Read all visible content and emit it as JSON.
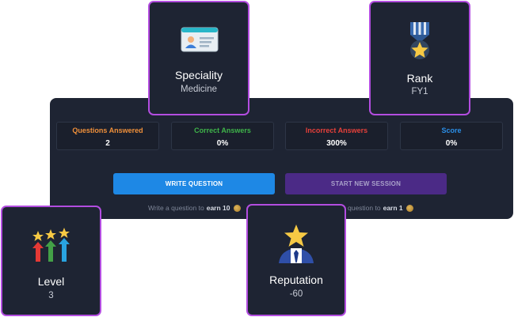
{
  "stats": [
    {
      "label": "Questions Answered",
      "value": "2",
      "color": "#f0903a"
    },
    {
      "label": "Correct Answers",
      "value": "0%",
      "color": "#3fb44a"
    },
    {
      "label": "Incorrect Answers",
      "value": "300%",
      "color": "#e5403a"
    },
    {
      "label": "Score",
      "value": "0%",
      "color": "#2b8fe8"
    }
  ],
  "actions": {
    "write_question": "WRITE QUESTION",
    "start_new_session": "START NEW SESSION"
  },
  "earn_hints": {
    "write": {
      "prefix": "Write a question to",
      "amount": "earn 10"
    },
    "session": {
      "prefix": "question to",
      "amount": "earn 1"
    }
  },
  "cards": {
    "speciality": {
      "title": "Speciality",
      "value": "Medicine",
      "icon": "id-card-icon"
    },
    "rank": {
      "title": "Rank",
      "value": "FY1",
      "icon": "medal-icon"
    },
    "level": {
      "title": "Level",
      "value": "3",
      "icon": "level-arrows-icon"
    },
    "reputation": {
      "title": "Reputation",
      "value": "-60",
      "icon": "star-person-icon"
    }
  },
  "colors": {
    "panel_bg": "#1e2433",
    "card_border": "#b34de0",
    "write_button": "#1e88e5",
    "session_button": "#4b2a86"
  }
}
